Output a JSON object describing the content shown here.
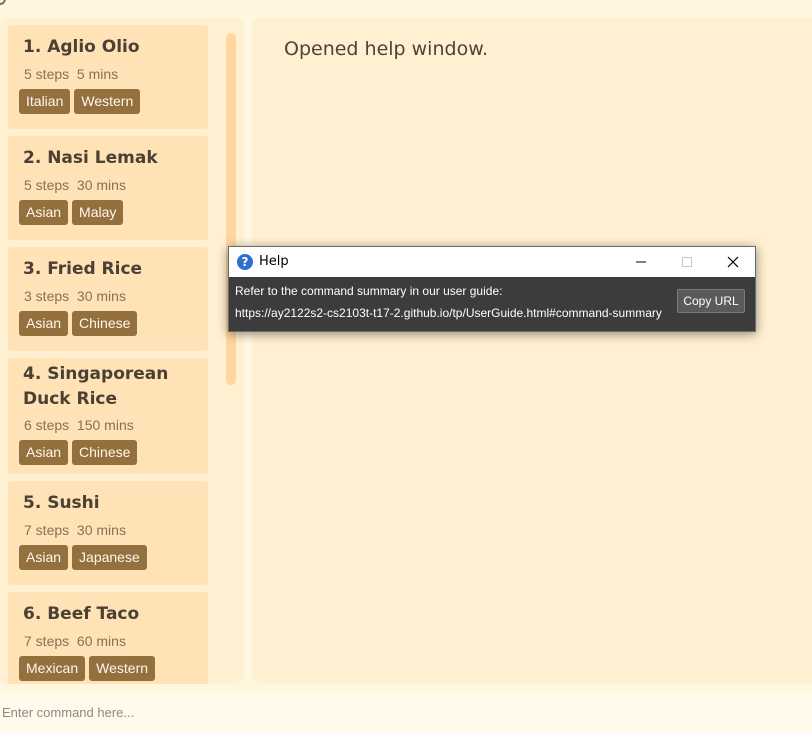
{
  "recipes": [
    {
      "title": "1. Aglio Olio",
      "steps": "5 steps",
      "time": "5 mins",
      "tags": [
        "Italian",
        "Western"
      ]
    },
    {
      "title": "2. Nasi Lemak",
      "steps": "5 steps",
      "time": "30 mins",
      "tags": [
        "Asian",
        "Malay"
      ]
    },
    {
      "title": "3. Fried Rice",
      "steps": "3 steps",
      "time": "30 mins",
      "tags": [
        "Asian",
        "Chinese"
      ]
    },
    {
      "title": "4. Singaporean Duck Rice",
      "steps": "6 steps",
      "time": "150 mins",
      "tags": [
        "Asian",
        "Chinese"
      ]
    },
    {
      "title": "5. Sushi",
      "steps": "7 steps",
      "time": "30 mins",
      "tags": [
        "Asian",
        "Japanese"
      ]
    },
    {
      "title": "6. Beef Taco",
      "steps": "7 steps",
      "time": "60 mins",
      "tags": [
        "Mexican",
        "Western"
      ]
    }
  ],
  "result": {
    "text": "Opened help window."
  },
  "command": {
    "placeholder": "Enter command here..."
  },
  "help_window": {
    "title": "Help",
    "icon": "question-icon",
    "message": "Refer to the command summary in our user guide:",
    "url": "https://ay2122s2-cs2103t-t17-2.github.io/tp/UserGuide.html#command-summary",
    "copy_button": "Copy URL"
  },
  "colors": {
    "card": "#ffe2b6",
    "tag": "#94703f",
    "panel": "#fff0d2",
    "dialog_body": "#3c3c3c"
  }
}
